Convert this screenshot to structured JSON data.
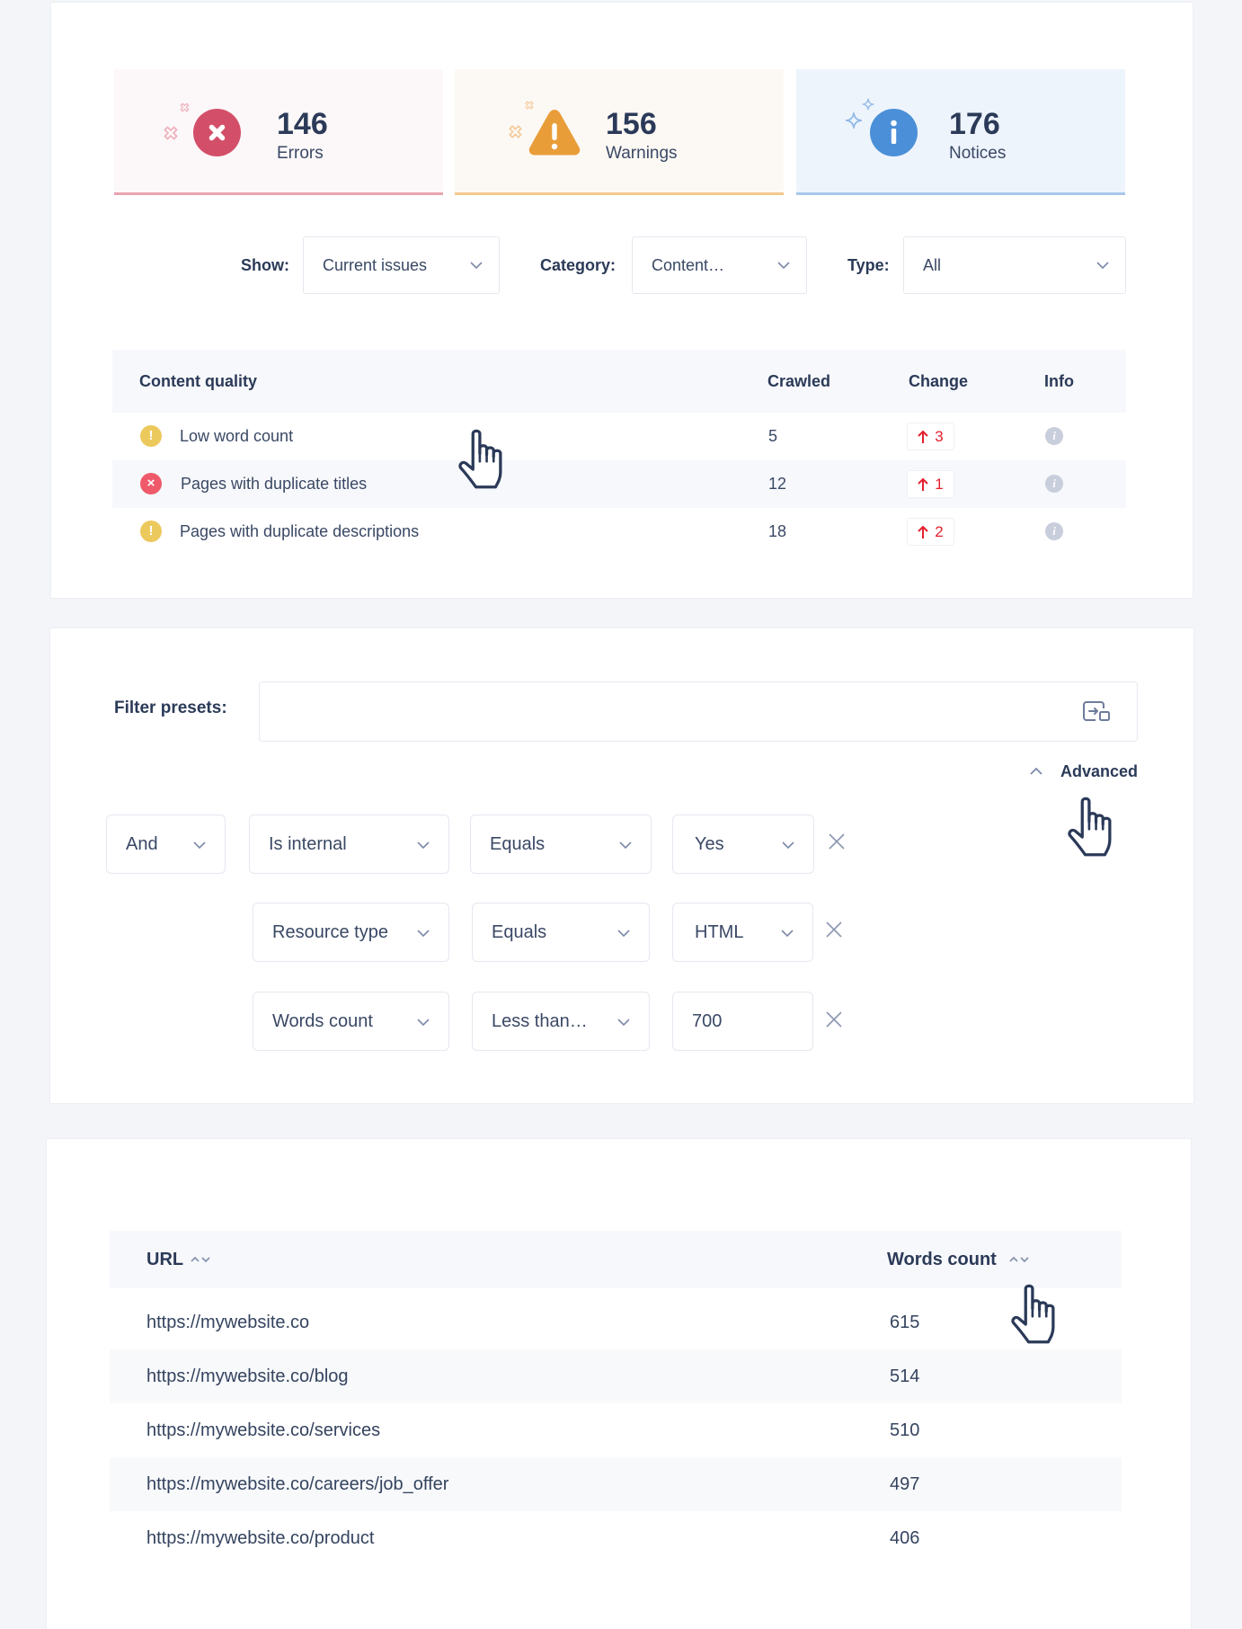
{
  "stats": [
    {
      "count": "146",
      "label": "Errors",
      "icon": "error-x-icon"
    },
    {
      "count": "156",
      "label": "Warnings",
      "icon": "warning-triangle-icon"
    },
    {
      "count": "176",
      "label": "Notices",
      "icon": "info-circle-icon"
    }
  ],
  "filters": {
    "show": {
      "label": "Show:",
      "value": "Current issues"
    },
    "category": {
      "label": "Category:",
      "value": "Content…"
    },
    "type": {
      "label": "Type:",
      "value": "All"
    }
  },
  "issues_table": {
    "columns": {
      "name": "Content quality",
      "crawled": "Crawled",
      "change": "Change",
      "info": "Info"
    },
    "rows": [
      {
        "severity": "warning",
        "severity_glyph": "!",
        "name": "Low word count",
        "crawled": "5",
        "change": "3",
        "change_direction": "up",
        "info_glyph": "i"
      },
      {
        "severity": "error",
        "severity_glyph": "×",
        "name": "Pages with duplicate titles",
        "crawled": "12",
        "change": "1",
        "change_direction": "up",
        "info_glyph": "i"
      },
      {
        "severity": "warning",
        "severity_glyph": "!",
        "name": "Pages with duplicate descriptions",
        "crawled": "18",
        "change": "2",
        "change_direction": "up",
        "info_glyph": "i"
      }
    ]
  },
  "filter_presets": {
    "label": "Filter presets:",
    "value": "",
    "placeholder": ""
  },
  "advanced_toggle": {
    "label": "Advanced",
    "expanded": true
  },
  "conditions": [
    {
      "connector": "And",
      "field": "Is internal",
      "operator": "Equals",
      "value": "Yes"
    },
    {
      "field": "Resource type",
      "operator": "Equals",
      "value": "HTML"
    },
    {
      "field": "Words count",
      "operator": "Less than…",
      "value": "700"
    }
  ],
  "results_table": {
    "columns": {
      "url": "URL",
      "words_count": "Words count"
    },
    "rows": [
      {
        "url": "https://mywebsite.co",
        "words_count": "615"
      },
      {
        "url": "https://mywebsite.co/blog",
        "words_count": "514"
      },
      {
        "url": "https://mywebsite.co/services",
        "words_count": "510"
      },
      {
        "url": "https://mywebsite.co/careers/job_offer",
        "words_count": "497"
      },
      {
        "url": "https://mywebsite.co/product",
        "words_count": "406"
      }
    ]
  },
  "colors": {
    "error": "#d34f69",
    "warning": "#e99d39",
    "notice": "#4b8fd8",
    "sev_warning": "#ecc95c",
    "sev_error": "#ef5a6a",
    "change_up": "#e4202e"
  }
}
